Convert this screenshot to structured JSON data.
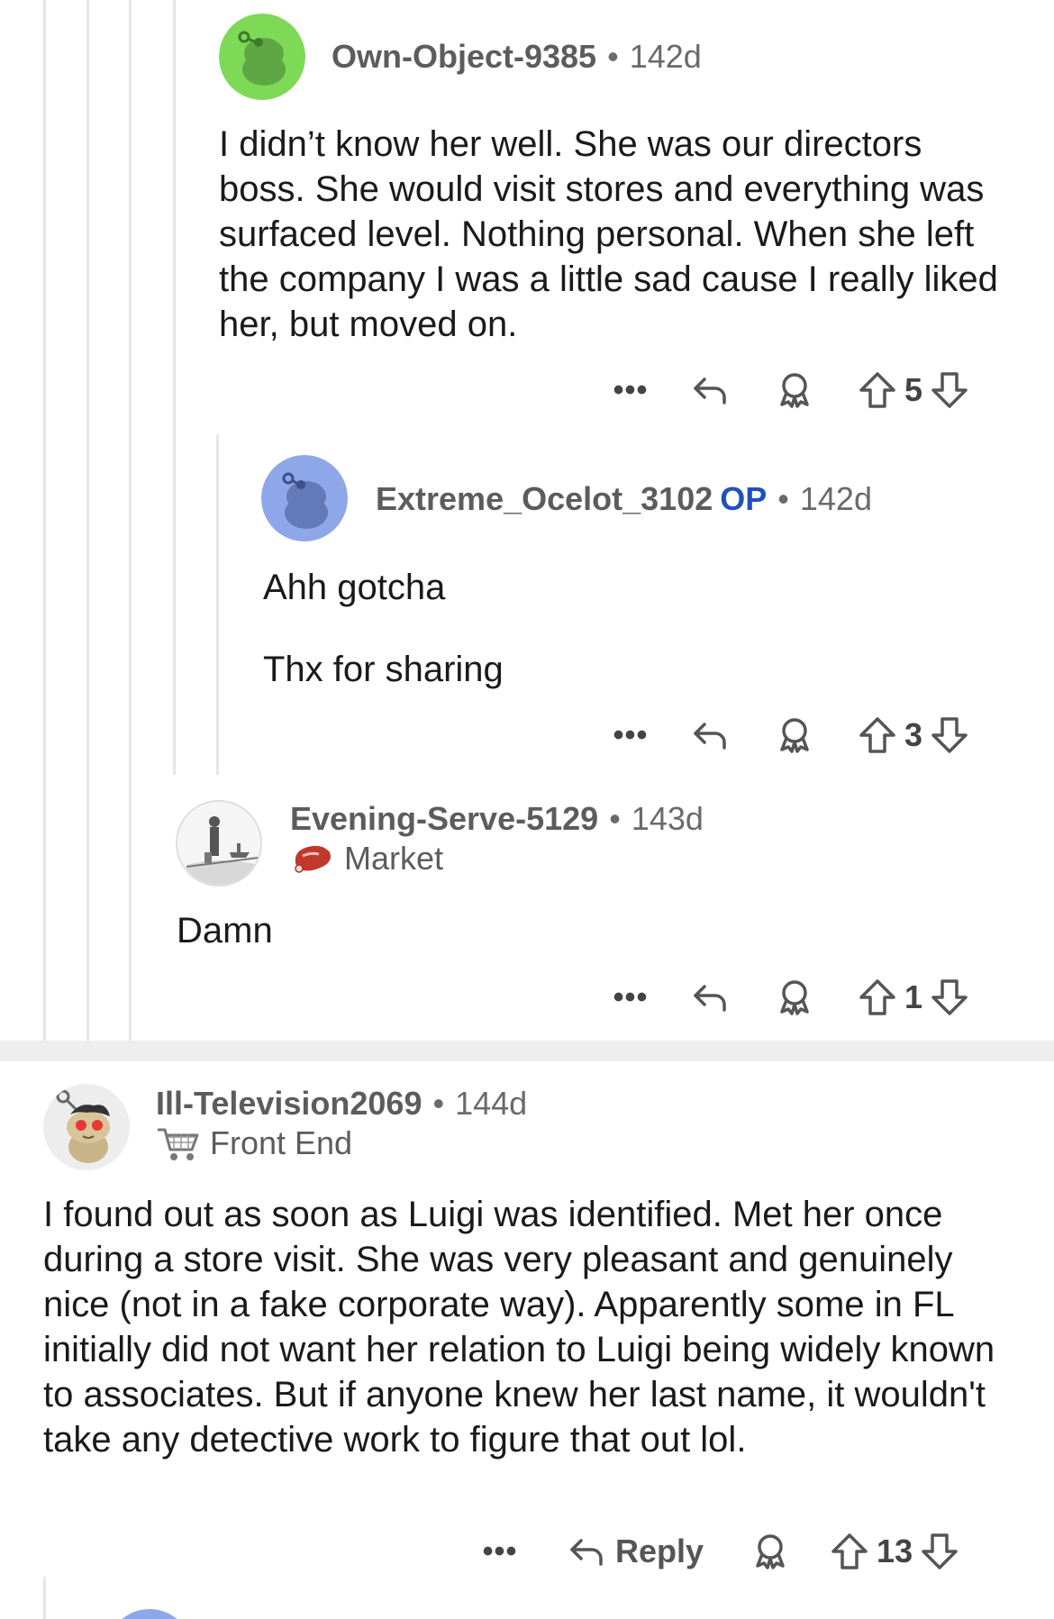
{
  "comments": [
    {
      "username": "Own-Object-9385",
      "age": "142d",
      "body": "I didn’t know her well. She was our directors boss. She would visit stores and everything was surfaced level. Nothing personal. When she left the company I was a little sad cause I really liked her, but moved on.",
      "votes": "5",
      "avatar_color": "#7ed957"
    },
    {
      "username": "Extreme_Ocelot_3102",
      "op_badge": "OP",
      "age": "142d",
      "body_line1": "Ahh gotcha",
      "body_line2": "Thx for sharing",
      "votes": "3",
      "avatar_color": "#8ea7e8"
    },
    {
      "username": "Evening-Serve-5129",
      "age": "143d",
      "flair": "Market",
      "flair_icon": "meat-icon",
      "body": "Damn",
      "votes": "1"
    },
    {
      "username": "Ill-Television2069",
      "age": "144d",
      "flair": "Front End",
      "flair_icon": "shopping-cart-icon",
      "body": "I found out as soon as Luigi was identified. Met her once during a store visit. She was very pleasant and genuinely nice (not in a fake corporate way). Apparently some in FL initially did not want her relation to Luigi being widely known to associates. But if anyone knew her last name, it wouldn't take any detective work to figure that out lol.",
      "votes": "13",
      "reply_label": "Reply"
    }
  ],
  "separator_dot": "•",
  "more_label": "•••",
  "colors": {
    "op_blue": "#2050c0",
    "thread_line": "#e6e6e6",
    "divider": "#eeeeef"
  }
}
